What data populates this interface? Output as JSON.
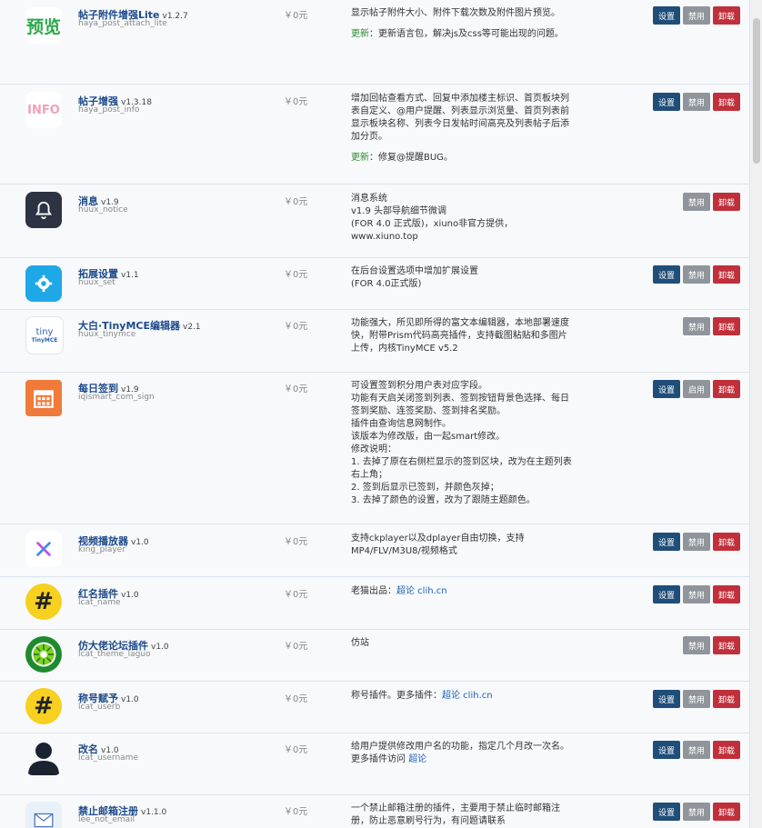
{
  "plugins": [
    {
      "name": "帖子附件增强Lite",
      "version": "v1.2.7",
      "slug": "haya_post_attach_lite",
      "price": "￥0元",
      "desc": "显示帖子附件大小、附件下载次数及附件图片预览。",
      "update_label": "更新",
      "update_text": "：更新语言包，解决js及css等可能出现的问题。",
      "icon": "preview-icon",
      "buttons": [
        "设置",
        "禁用",
        "卸载"
      ]
    },
    {
      "name": "帖子增强",
      "version": "v1.3.18",
      "slug": "haya_post_info",
      "price": "￥0元",
      "desc": "增加回帖查看方式、回复中添加楼主标识、首页板块列表自定义、@用户提醒、列表显示浏览量、首页列表前显示板块名称、列表今日发帖时间高亮及列表帖子后添加分页。",
      "update_label": "更新",
      "update_text": "：修复@提醒BUG。",
      "icon": "info-icon",
      "buttons": [
        "设置",
        "禁用",
        "卸载"
      ]
    },
    {
      "name": "消息",
      "version": "v1.9",
      "slug": "huux_notice",
      "price": "￥0元",
      "desc": "消息系统\nv1.9 头部导航细节微调\n(FOR 4.0 正式版)，xiuno非官方提供，\nwww.xiuno.top",
      "icon": "bell-icon",
      "buttons": [
        "禁用",
        "卸载"
      ]
    },
    {
      "name": "拓展设置",
      "version": "v1.1",
      "slug": "huux_set",
      "price": "￥0元",
      "desc": "在后台设置选项中增加扩展设置\n(FOR 4.0正式版)",
      "icon": "gear-icon",
      "buttons": [
        "设置",
        "禁用",
        "卸载"
      ]
    },
    {
      "name": "大白·TinyMCE编辑器",
      "version": "v2.1",
      "slug": "huux_tinymce",
      "price": "￥0元",
      "desc": "功能强大，所见即所得的富文本编辑器，本地部署速度快，附带Prism代码高亮插件，支持截图粘贴和多图片上传，内核TinyMCE v5.2",
      "icon": "tinymce-icon",
      "icon_text1": "tiny",
      "icon_text2": "TinyMCE",
      "buttons": [
        "禁用",
        "卸载"
      ]
    },
    {
      "name": "每日签到",
      "version": "v1.9",
      "slug": "iqismart_com_sign",
      "price": "￥0元",
      "desc": "可设置签到积分用户表对应字段。\n功能有天启关闭签到列表、签到按钮背景色选择、每日签到奖励、连签奖励、签到排名奖励。\n插件由查询信息网制作。\n该版本为修改版，由一起smart修改。\n修改说明：\n1. 去掉了原在右侧栏显示的签到区块，改为在主题列表右上角；\n2. 签到后显示已签到，并颜色灰掉；\n3. 去掉了颜色的设置，改为了跟随主题颜色。",
      "icon": "calendar-icon",
      "buttons": [
        "设置",
        "启用",
        "卸载"
      ]
    },
    {
      "name": "视频播放器",
      "version": "v1.0",
      "slug": "king_player",
      "price": "￥0元",
      "desc": "支持ckplayer以及dplayer自由切换，支持MP4/FLV/M3U8/视频格式",
      "icon": "player-icon",
      "buttons": [
        "设置",
        "禁用",
        "卸载"
      ]
    },
    {
      "name": "红名插件",
      "version": "v1.0",
      "slug": "lcat_name",
      "price": "￥0元",
      "desc": "老猫出品：",
      "link": "超论 clih.cn",
      "icon": "hash-icon",
      "buttons": [
        "设置",
        "禁用",
        "卸载"
      ]
    },
    {
      "name": "仿大佬论坛插件",
      "version": "v1.0",
      "slug": "lcat_theme_laguo",
      "price": "￥0元",
      "desc": "仿站",
      "icon": "kiwi-icon",
      "buttons": [
        "禁用",
        "卸载"
      ]
    },
    {
      "name": "称号赋予",
      "version": "v1.0",
      "slug": "lcat_userb",
      "price": "￥0元",
      "desc": "称号插件。更多插件：",
      "link": "超论 clih.cn",
      "icon": "hash-icon",
      "buttons": [
        "设置",
        "禁用",
        "卸载"
      ]
    },
    {
      "name": "改名",
      "version": "v1.0",
      "slug": "lcat_username",
      "price": "￥0元",
      "desc": "给用户提供修改用户名的功能，指定几个月改一次名。\n更多插件访问 ",
      "link": "超论",
      "icon": "user-icon",
      "buttons": [
        "设置",
        "禁用",
        "卸载"
      ]
    },
    {
      "name": "禁止邮箱注册",
      "version": "v1.1.0",
      "slug": "lee_not_email",
      "price": "￥0元",
      "desc": "一个禁止邮箱注册的插件，主要用于禁止临时邮箱注册，防止恶意刷号行为，有问题请联系",
      "icon": "mail-icon",
      "buttons": [
        "设置",
        "禁用",
        "卸载"
      ]
    }
  ]
}
